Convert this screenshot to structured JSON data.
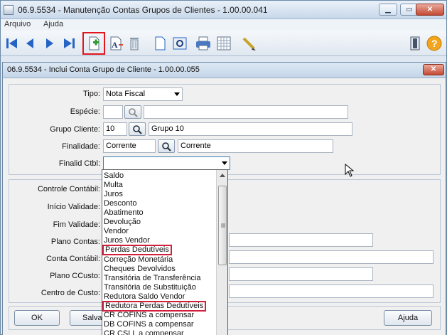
{
  "window": {
    "title": "06.9.5534 - Manutenção Contas Grupos de Clientes - 1.00.00.041"
  },
  "menu": {
    "items": [
      "Arquivo",
      "Ajuda"
    ]
  },
  "toolbar": {
    "icons": [
      "first-icon",
      "prev-icon",
      "next-icon",
      "last-icon",
      "new-record-icon",
      "edit-icon",
      "delete-icon",
      "document-icon",
      "preview-icon",
      "print-icon",
      "grid-icon",
      "pencil-icon",
      "exit-icon",
      "help-icon"
    ],
    "highlight_color": "#e0171d"
  },
  "dialog": {
    "title": "06.9.5534 - Inclui Conta Grupo de Cliente - 1.00.00.055",
    "fields": {
      "tipo": {
        "label": "Tipo:",
        "value": "Nota Fiscal"
      },
      "especie": {
        "label": "Espécie:",
        "value": "",
        "desc": ""
      },
      "grupo_cliente": {
        "label": "Grupo Cliente:",
        "value": "10",
        "desc": "Grupo 10"
      },
      "finalidade": {
        "label": "Finalidade:",
        "value": "Corrente",
        "desc": "Corrente"
      },
      "finalid_ctbl": {
        "label": "Finalid Ctbl:",
        "value": ""
      }
    },
    "lower_labels": {
      "controle_contabil": "Controle Contábil:",
      "inicio_validade": "Início Validade:",
      "fim_validade": "Fim Validade:",
      "plano_contas": "Plano Contas:",
      "conta_contabil": "Conta Contábil:",
      "plano_ccusto": "Plano CCusto:",
      "centro_custo": "Centro de Custo:"
    },
    "buttons": {
      "ok": "OK",
      "salvar": "Salva",
      "ajuda": "Ajuda"
    }
  },
  "dropdown": {
    "options": [
      "Saldo",
      "Multa",
      "Juros",
      "Desconto",
      "Abatimento",
      "Devolução",
      "Vendor",
      "Juros Vendor",
      "Perdas Dedutíveis",
      "Correção Monetária",
      "Cheques Devolvidos",
      "Transitória de Transferência",
      "Transitória de Substituição",
      "Redutora Saldo Vendor",
      "Redutora Perdas Dedutíveis",
      "CR COFINS a compensar",
      "DB COFINS a compensar",
      "CR CSLL a compensar"
    ],
    "highlighted": [
      "Perdas Dedutíveis",
      "Redutora Perdas Dedutíveis"
    ],
    "highlight_color": "#d21f3c"
  }
}
